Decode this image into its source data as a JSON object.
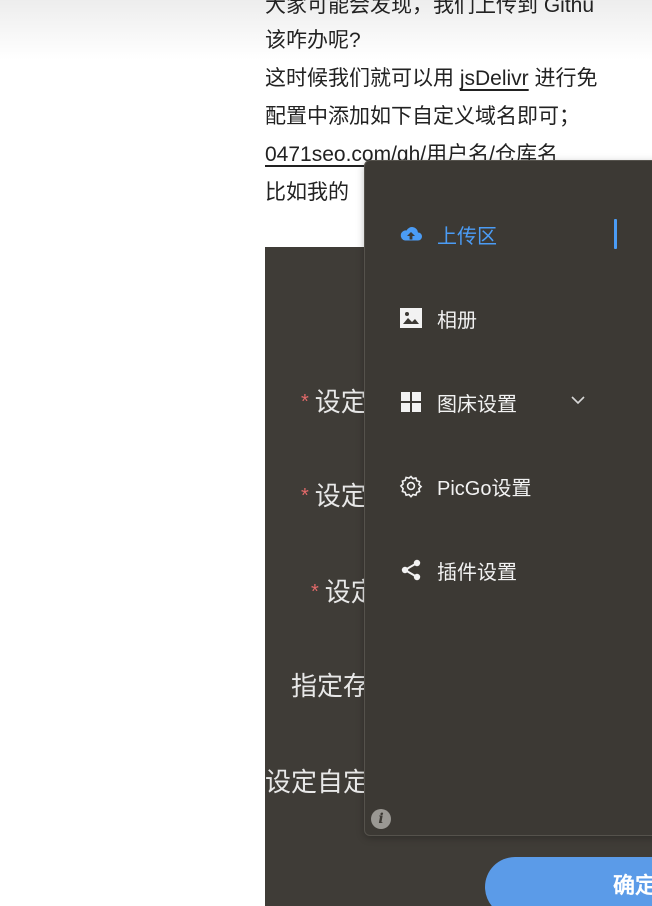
{
  "article": {
    "line1": "大家可能会发现，我们上传到 Githu",
    "line2": "该咋办呢?",
    "line3_pre": "这时候我们就可以用 ",
    "line3_link": "jsDelivr",
    "line3_post": " 进行免",
    "line4": "配置中添加如下自定义域名即可；",
    "line5": "0471seo.com/gh/用户名/仓库名",
    "line6": "比如我的"
  },
  "form": {
    "labels": [
      "设定",
      "设定",
      "设定",
      "指定存",
      "设定自定"
    ],
    "required_mark": "*",
    "confirm_label": "确定"
  },
  "menu": {
    "items": [
      {
        "label": "上传区",
        "icon": "cloud-upload-icon",
        "active": true
      },
      {
        "label": "相册",
        "icon": "image-icon"
      },
      {
        "label": "图床设置",
        "icon": "grid-icon"
      },
      {
        "label": "PicGo设置",
        "icon": "gear-icon"
      },
      {
        "label": "插件设置",
        "icon": "share-icon"
      }
    ],
    "info_glyph": "i"
  },
  "colors": {
    "accent": "#4b9cf5",
    "panel_bg": "#3c3934",
    "required": "#e46a6a",
    "button": "#5b9be8"
  }
}
